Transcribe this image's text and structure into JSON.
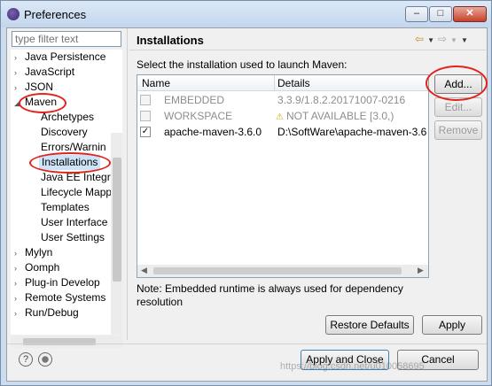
{
  "window": {
    "title": "Preferences",
    "minimize": "–",
    "maximize": "□",
    "close": "✕"
  },
  "filter": {
    "placeholder": "type filter text"
  },
  "tree": {
    "items": [
      {
        "label": "Java Persistence",
        "arrow": "›"
      },
      {
        "label": "JavaScript",
        "arrow": "›"
      },
      {
        "label": "JSON",
        "arrow": "›"
      },
      {
        "label": "Maven",
        "arrow": "◢"
      },
      {
        "label": "Archetypes"
      },
      {
        "label": "Discovery"
      },
      {
        "label": "Errors/Warnin"
      },
      {
        "label": "Installations"
      },
      {
        "label": "Java EE Integra"
      },
      {
        "label": "Lifecycle Mapp"
      },
      {
        "label": "Templates"
      },
      {
        "label": "User Interface"
      },
      {
        "label": "User Settings"
      },
      {
        "label": "Mylyn",
        "arrow": "›"
      },
      {
        "label": "Oomph",
        "arrow": "›"
      },
      {
        "label": "Plug-in Develop",
        "arrow": "›"
      },
      {
        "label": "Remote Systems",
        "arrow": "›"
      },
      {
        "label": "Run/Debug",
        "arrow": "›"
      }
    ]
  },
  "page": {
    "title": "Installations",
    "instruction": "Select the installation used to launch Maven:",
    "columns": {
      "name": "Name",
      "details": "Details"
    },
    "rows": [
      {
        "name": "EMBEDDED",
        "details": "3.3.9/1.8.2.20171007-0216",
        "checked": ""
      },
      {
        "name": "WORKSPACE",
        "details": "NOT AVAILABLE [3.0,)",
        "checked": ""
      },
      {
        "name": "apache-maven-3.6.0",
        "details": "D:\\SoftWare\\apache-maven-3.6",
        "checked": "✓"
      }
    ],
    "buttons": {
      "add": "Add...",
      "edit": "Edit...",
      "remove": "Remove"
    },
    "note": "Note: Embedded runtime is always used for dependency resolution",
    "restore_defaults": "Restore Defaults",
    "apply": "Apply"
  },
  "dialog": {
    "apply_and_close": "Apply and Close",
    "cancel": "Cancel",
    "help": "?"
  },
  "watermark": "https://blog.csdn.net/u010058695",
  "colors": {
    "annotation_red": "#e0231b",
    "selection": "#cde3f8"
  }
}
